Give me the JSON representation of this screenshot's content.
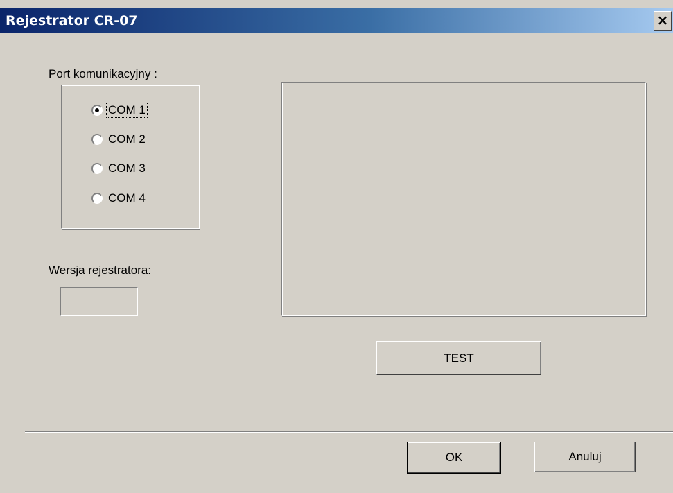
{
  "window": {
    "title": "Rejestrator CR-07",
    "close_label": "✕"
  },
  "port_group": {
    "label": "Port komunikacyjny :",
    "options": [
      {
        "label": "COM 1",
        "checked": true
      },
      {
        "label": "COM 2",
        "checked": false
      },
      {
        "label": "COM 3",
        "checked": false
      },
      {
        "label": "COM 4",
        "checked": false
      }
    ]
  },
  "version": {
    "label": "Wersja rejestratora:",
    "value": ""
  },
  "buttons": {
    "test": "TEST",
    "ok": "OK",
    "cancel": "Anuluj"
  }
}
